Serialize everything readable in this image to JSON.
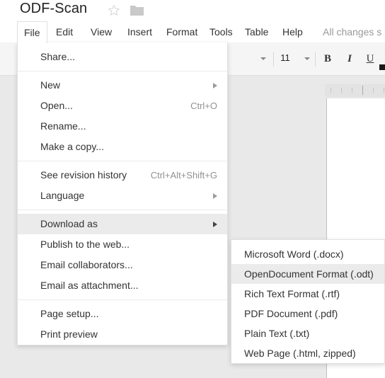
{
  "titlebar": {
    "doc_title": "ODF-Scan",
    "star_icon": "star-icon",
    "folder_icon": "folder-icon"
  },
  "menubar": {
    "items": [
      {
        "label": "File",
        "active": true
      },
      {
        "label": "Edit",
        "active": false
      },
      {
        "label": "View",
        "active": false
      },
      {
        "label": "Insert",
        "active": false
      },
      {
        "label": "Format",
        "active": false
      },
      {
        "label": "Tools",
        "active": false
      },
      {
        "label": "Table",
        "active": false
      },
      {
        "label": "Help",
        "active": false
      }
    ],
    "save_status": "All changes s"
  },
  "toolbar": {
    "font_size": "11",
    "bold_label": "B",
    "italic_label": "I",
    "underline_label": "U"
  },
  "file_menu": {
    "items": [
      {
        "label": "Share...",
        "accel": "",
        "arrow": false,
        "highlighted": false
      },
      {
        "separator": true
      },
      {
        "label": "New",
        "accel": "",
        "arrow": true,
        "highlighted": false
      },
      {
        "label": "Open...",
        "accel": "Ctrl+O",
        "arrow": false,
        "highlighted": false
      },
      {
        "label": "Rename...",
        "accel": "",
        "arrow": false,
        "highlighted": false
      },
      {
        "label": "Make a copy...",
        "accel": "",
        "arrow": false,
        "highlighted": false
      },
      {
        "separator": true
      },
      {
        "label": "See revision history",
        "accel": "Ctrl+Alt+Shift+G",
        "arrow": false,
        "highlighted": false
      },
      {
        "label": "Language",
        "accel": "",
        "arrow": true,
        "highlighted": false
      },
      {
        "separator": true
      },
      {
        "label": "Download as",
        "accel": "",
        "arrow": true,
        "highlighted": true
      },
      {
        "label": "Publish to the web...",
        "accel": "",
        "arrow": false,
        "highlighted": false
      },
      {
        "label": "Email collaborators...",
        "accel": "",
        "arrow": false,
        "highlighted": false
      },
      {
        "label": "Email as attachment...",
        "accel": "",
        "arrow": false,
        "highlighted": false
      },
      {
        "separator": true
      },
      {
        "label": "Page setup...",
        "accel": "",
        "arrow": false,
        "highlighted": false
      },
      {
        "label": "Print preview",
        "accel": "",
        "arrow": false,
        "highlighted": false
      }
    ]
  },
  "download_submenu": {
    "items": [
      {
        "label": "Microsoft Word (.docx)",
        "highlighted": false
      },
      {
        "label": "OpenDocument Format (.odt)",
        "highlighted": true
      },
      {
        "label": "Rich Text Format (.rtf)",
        "highlighted": false
      },
      {
        "label": "PDF Document (.pdf)",
        "highlighted": false
      },
      {
        "label": "Plain Text (.txt)",
        "highlighted": false
      },
      {
        "label": "Web Page (.html, zipped)",
        "highlighted": false
      }
    ]
  },
  "colors": {
    "highlight": "#ebebeb",
    "toolbar_bg": "#f5f5f5",
    "canvas_bg": "#e9e9e9",
    "text": "#333333",
    "muted_text": "#919191"
  }
}
